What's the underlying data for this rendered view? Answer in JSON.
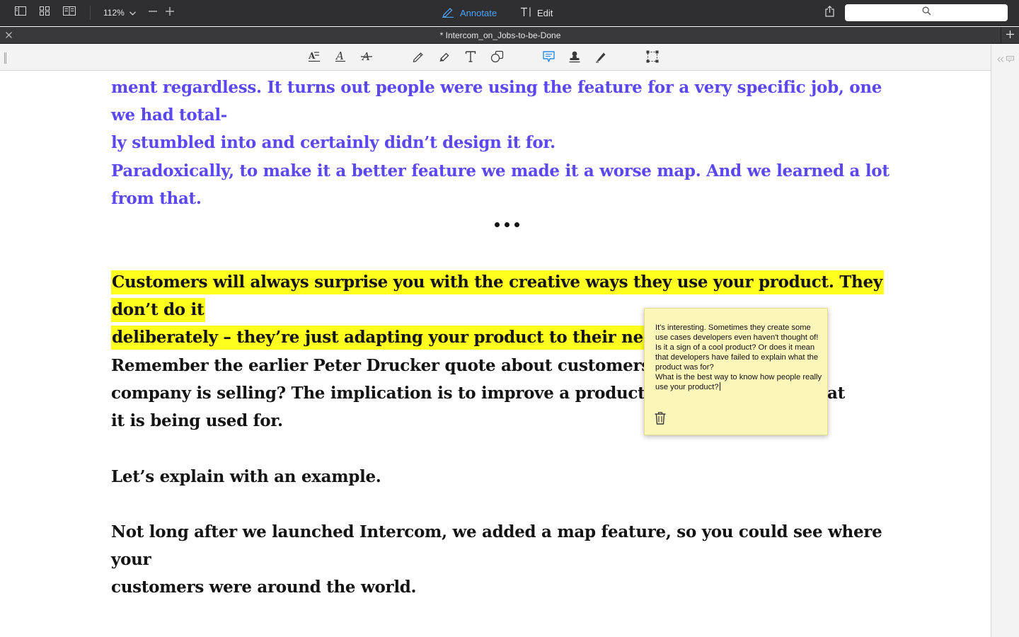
{
  "window": {
    "zoom": "112%",
    "modes": {
      "annotate": "Annotate",
      "edit": "Edit",
      "active": "annotate"
    },
    "document_title": "* Intercom_on_Jobs-to-be-Done"
  },
  "colors": {
    "accent": "#4aa3ff",
    "highlight": "#ffff1e",
    "quote_text": "#5b48ee",
    "note_bg": "#fdf6bb"
  },
  "icons": {
    "topbar": [
      "sidebar-icon",
      "thumbnails-icon",
      "two-page-icon",
      "zoom-out-icon",
      "zoom-in-icon",
      "share-icon",
      "search-icon"
    ],
    "annotation_tools": [
      "text-edit-icon",
      "text-style-icon",
      "strikethrough-icon",
      "pencil-icon",
      "highlighter-icon",
      "text-box-icon",
      "shapes-icon",
      "note-icon",
      "stamp-icon",
      "pen-signature-icon",
      "selection-icon"
    ],
    "active_tool": "note-icon"
  },
  "document": {
    "paragraphs": {
      "p1_line1": "ment regardless. It turns out people were using the feature for a very specific job, one we had total-",
      "p1_line2": "ly stumbled into and certainly didn’t design it for.",
      "p2": "Paradoxically, to make it a better feature we made it a worse map. And we learned a lot from that.",
      "p3_line1": "Customers will always surprise you with the creative ways they use your product. They don’t do it",
      "p3_line2": "deliberately – they’re just adapting your product to their needs.",
      "p4_line1": "Remember the earlier Peter Drucker quote about customers rarely",
      "p4_line2a": "company is selling? The implication is to improve a product you m",
      "p4_line2b": "at",
      "p4_line3": "it is being used for.",
      "p5": "Let’s explain with an example.",
      "p6_line1": "Not long after we launched Intercom, we added a map feature, so you could see where your",
      "p6_line2": "customers were around the world."
    },
    "separator": "•••"
  },
  "sticky_note": {
    "text": "It's interesting. Sometimes they create some use cases developers even haven't thought of!\nIs it a sign of a cool product? Or does it mean that developers have failed to explain what the product was for?\nWhat is the best way to know how people really use your product?"
  }
}
